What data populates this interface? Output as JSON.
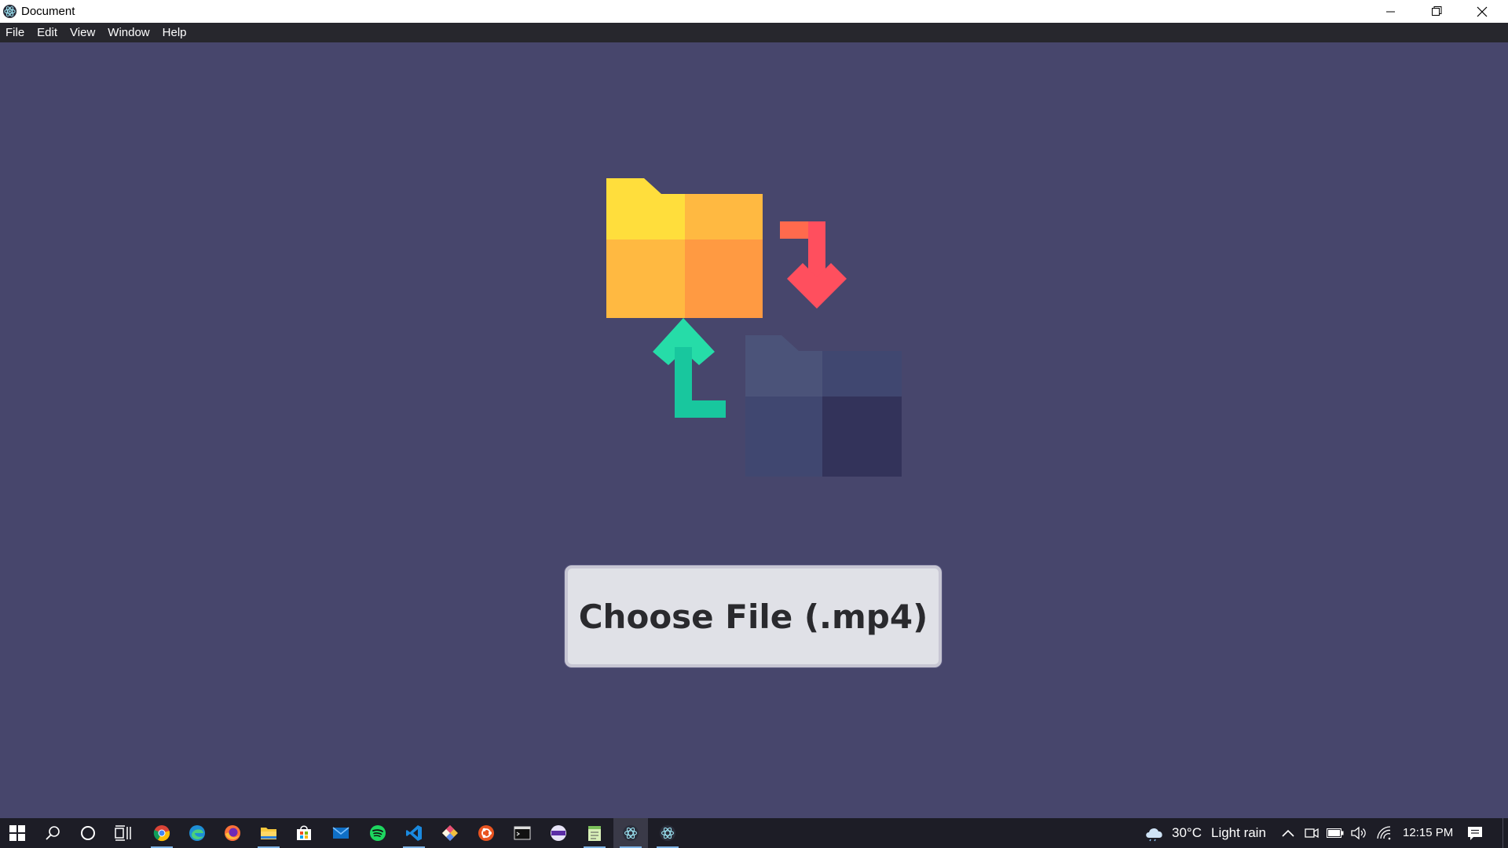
{
  "window": {
    "title": "Document",
    "controls": [
      "minimize-icon",
      "restore-icon",
      "close-icon"
    ]
  },
  "menu": {
    "items": [
      "File",
      "Edit",
      "View",
      "Window",
      "Help"
    ]
  },
  "main": {
    "illustration_icon": "folder-transfer-illustration",
    "choose_button_label": "Choose File (.mp4)"
  },
  "taskbar": {
    "apps": [
      "windows-start-icon",
      "search-icon",
      "cortana-icon",
      "task-view-icon",
      "chrome-icon",
      "edge-icon",
      "firefox-icon",
      "file-explorer-icon",
      "store-icon",
      "mail-icon",
      "spotify-icon",
      "vscode-icon",
      "git-icon",
      "ubuntu-icon",
      "terminal-icon",
      "app-icon",
      "notepad-icon",
      "electron-icon",
      "electron-icon"
    ],
    "weather": {
      "icon": "cloud-rain-icon",
      "temperature": "30°C",
      "condition": "Light rain"
    },
    "tray_icons": [
      "chevron-up-icon",
      "meet-now-icon",
      "battery-icon",
      "volume-icon",
      "wifi-icon"
    ],
    "clock": "12:15 PM",
    "notification_icon": "notification-icon"
  },
  "colors": {
    "background": "#47466c",
    "menubar": "#27272d",
    "taskbar": "#1d1d26",
    "button_bg": "#e0e1e7",
    "folder_yellow": "#ffd83b",
    "folder_orange": "#ff9a42",
    "arrow_red": "#ff4f5e",
    "arrow_green": "#18c79e",
    "folder_dark": "#3a3a5c"
  }
}
